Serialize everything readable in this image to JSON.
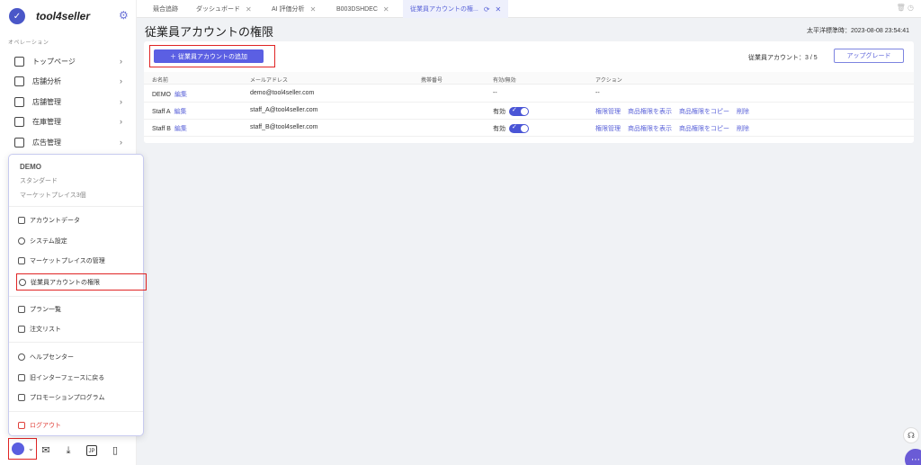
{
  "brand": {
    "name": "tool4seller"
  },
  "sidebar": {
    "section_label": "オペレーション",
    "items": [
      {
        "label": "トップページ",
        "icon": "home-icon"
      },
      {
        "label": "店舗分析",
        "icon": "chart-icon"
      },
      {
        "label": "店舗管理",
        "icon": "store-icon"
      },
      {
        "label": "在庫管理",
        "icon": "inventory-icon"
      },
      {
        "label": "広告管理",
        "icon": "monitor-icon"
      }
    ]
  },
  "popup": {
    "account_name": "DEMO",
    "plan": "スタンダード",
    "marketplaces": "マーケットプレイス3個",
    "items": [
      {
        "label": "アカウントデータ"
      },
      {
        "label": "システム設定"
      },
      {
        "label": "マーケットプレイスの管理"
      },
      {
        "label": "従業員アカウントの権限"
      },
      {
        "label": "プラン一覧"
      },
      {
        "label": "注文リスト"
      },
      {
        "label": "ヘルプセンター"
      },
      {
        "label": "旧インターフェースに戻る"
      },
      {
        "label": "プロモーションプログラム"
      },
      {
        "label": "ログアウト"
      }
    ]
  },
  "bottom_bar": {
    "jp_label": "JP"
  },
  "tabs": [
    {
      "label": "競合追跡"
    },
    {
      "label": "ダッシュボード"
    },
    {
      "label": "AI 評価分析"
    },
    {
      "label": "B003DSHDEC"
    },
    {
      "label": "従業員アカウントの権..."
    }
  ],
  "header": {
    "title": "従業員アカウントの権限",
    "timestamp": "太平洋標準時：2023-08-08 23:54:41"
  },
  "toolbar": {
    "add_button": "＋ 従業員アカウントの追加",
    "count": "従業員アカウント：3 / 5",
    "upgrade_button": "アップグレード"
  },
  "table": {
    "columns": [
      "お名前",
      "メールアドレス",
      "携帯番号",
      "有効/無効",
      "アクション"
    ],
    "edit_label": "編集",
    "rows": [
      {
        "name": "DEMO",
        "email": "demo@tool4seller.com",
        "phone": "",
        "status": "--",
        "actions": "--"
      },
      {
        "name": "Staff A",
        "email": "staff_A@tool4seller.com",
        "phone": "",
        "status": "有効",
        "actions": [
          "権限管理",
          "商品権限を表示",
          "商品権限をコピー",
          "削除"
        ]
      },
      {
        "name": "Staff B",
        "email": "staff_B@tool4seller.com",
        "phone": "",
        "status": "有効",
        "actions": [
          "権限管理",
          "商品権限を表示",
          "商品権限をコピー",
          "削除"
        ]
      }
    ]
  },
  "colors": {
    "accent": "#5b5fe3",
    "highlight": "#e02424"
  }
}
